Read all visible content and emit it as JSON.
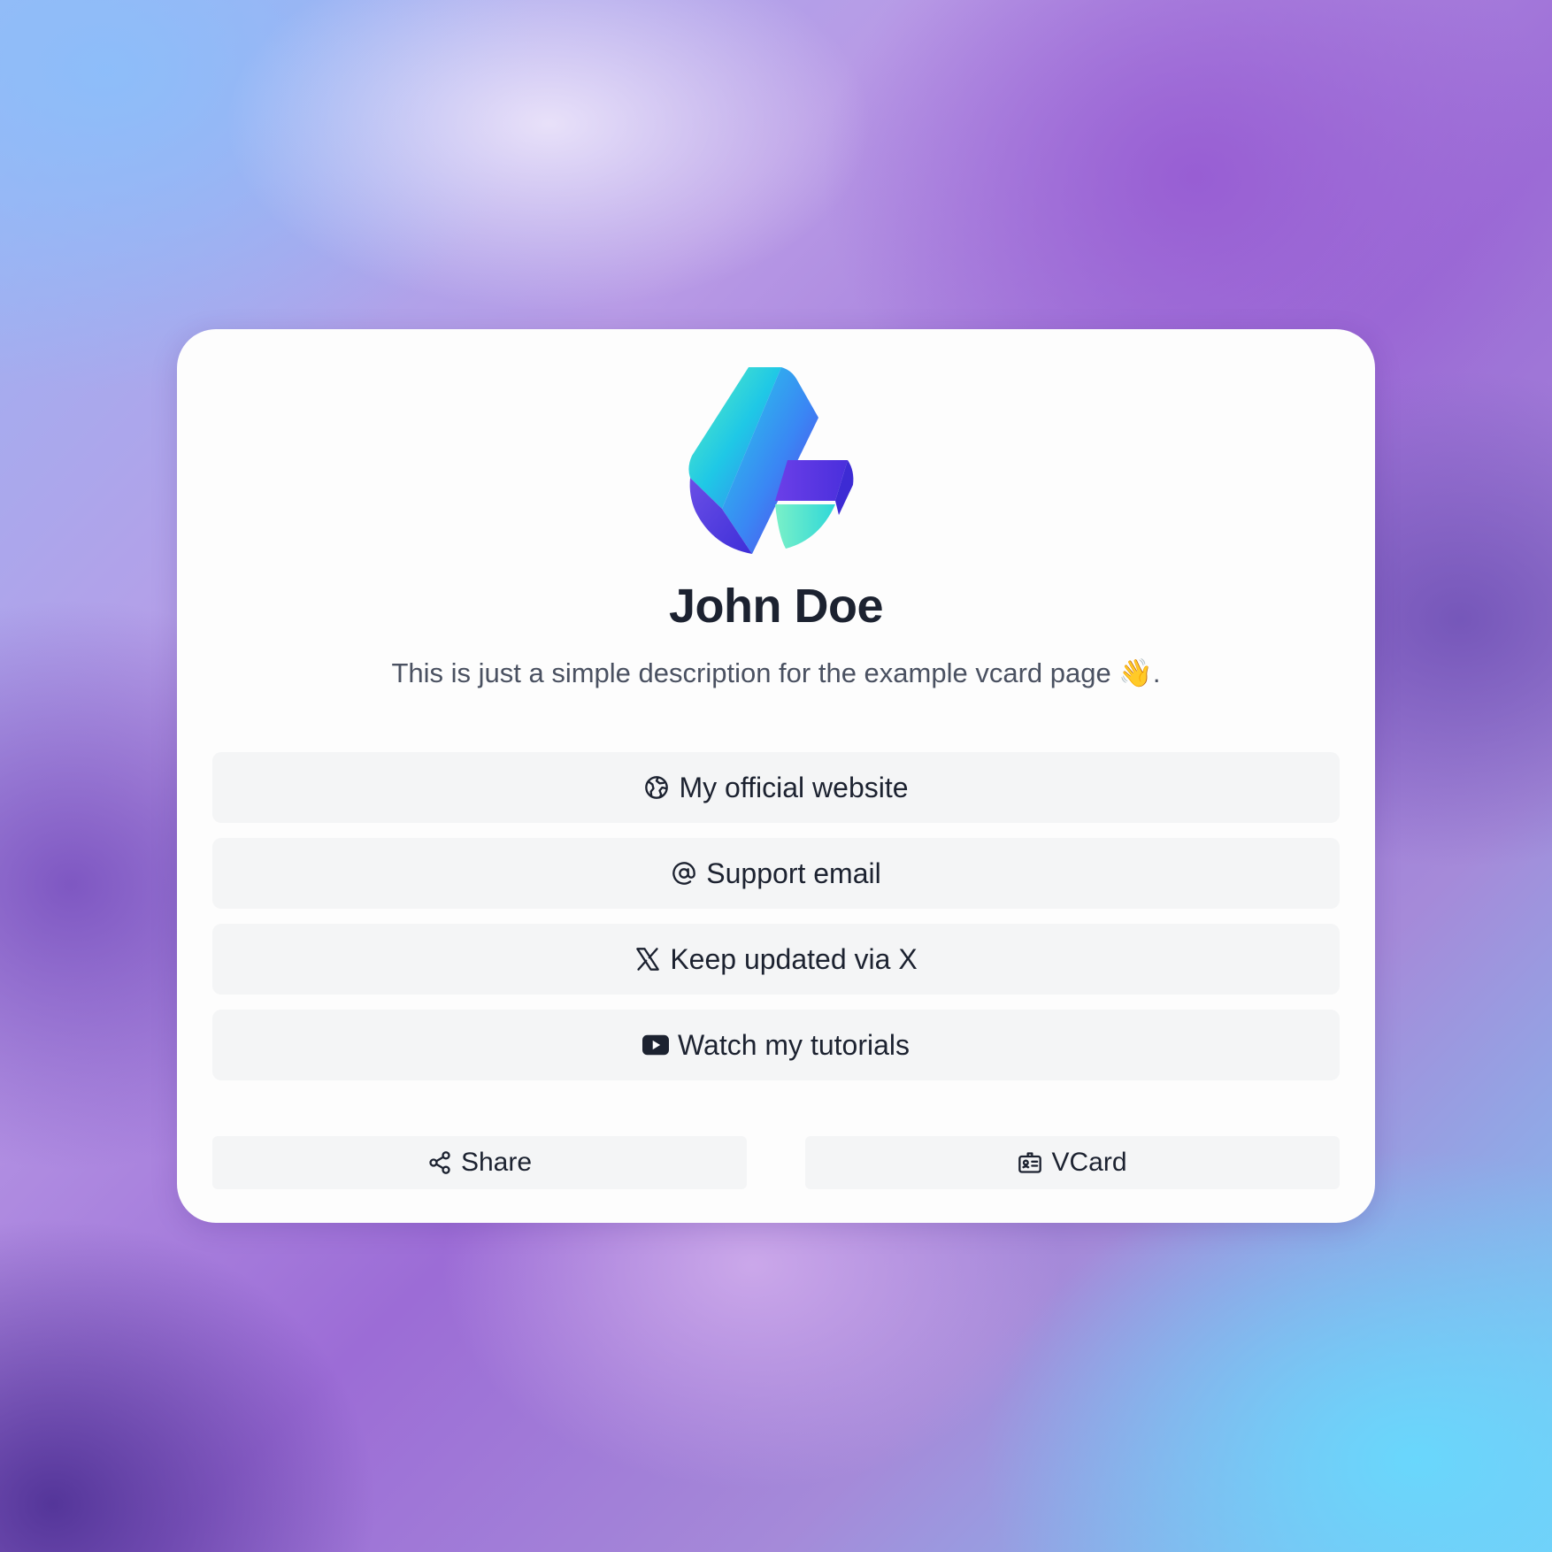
{
  "profile": {
    "name": "John Doe",
    "description": "This is just a simple description for the example vcard page 👋."
  },
  "links": [
    {
      "label": "My official website",
      "icon": "globe-icon"
    },
    {
      "label": "Support email",
      "icon": "at-icon"
    },
    {
      "label": "Keep updated via X",
      "icon": "x-logo-icon"
    },
    {
      "label": "Watch my tutorials",
      "icon": "youtube-icon"
    }
  ],
  "actions": {
    "share_label": "Share",
    "vcard_label": "VCard"
  },
  "colors": {
    "text": "#1c2230",
    "muted": "#4a5161",
    "button_bg": "#f4f5f6",
    "logo_teal": "#3ee6c8",
    "logo_blue": "#3b82f6",
    "logo_purple": "#5b32e0"
  }
}
